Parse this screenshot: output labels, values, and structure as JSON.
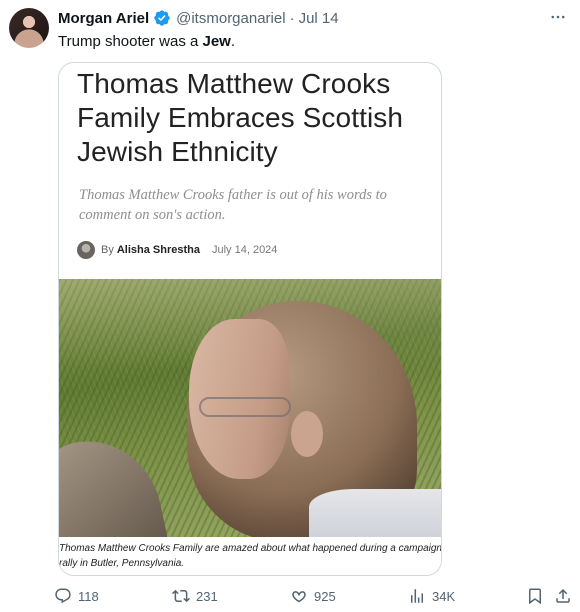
{
  "tweet": {
    "display_name": "Morgan Ariel",
    "handle": "@itsmorganariel",
    "separator": "·",
    "date": "Jul 14",
    "text_plain": "Trump shooter was a ",
    "text_bold": "Jew",
    "text_end": "."
  },
  "article": {
    "title": "Thomas Matthew Crooks Family Embraces Scottish Jewish Ethnicity",
    "subtitle": "Thomas Matthew Crooks father is out of his words to comment on son's action.",
    "by": "By",
    "author": "Alisha Shrestha",
    "date": "July 14, 2024",
    "caption": "Thomas Matthew Crooks Family are amazed about what happened during a campaign rally in Butler, Pennsylvania."
  },
  "actions": {
    "replies": "118",
    "reposts": "231",
    "likes": "925",
    "views": "34K"
  },
  "colors": {
    "verified": "#1d9bf0",
    "secondary_text": "#536471",
    "border": "#cfd9de"
  },
  "icons": [
    "verified-icon",
    "more-icon",
    "reply-icon",
    "repost-icon",
    "like-icon",
    "views-icon",
    "bookmark-icon",
    "share-icon"
  ]
}
